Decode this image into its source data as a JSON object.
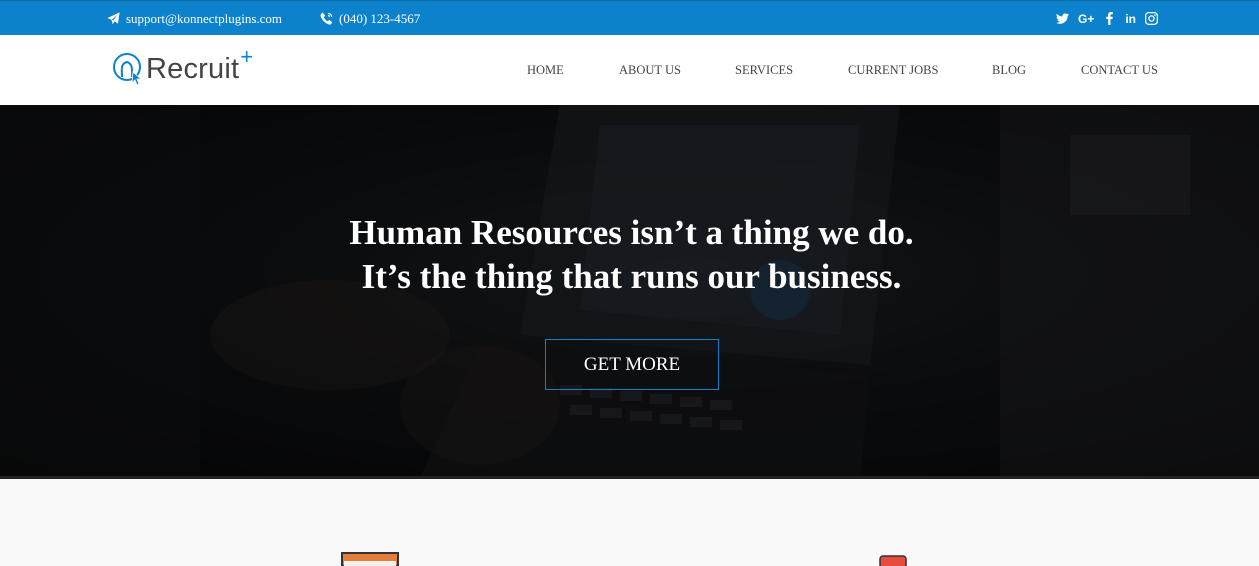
{
  "topbar": {
    "email": "support@konnectplugins.com",
    "phone": "(040) 123-4567",
    "social": [
      "twitter-icon",
      "google-plus-icon",
      "facebook-icon",
      "linkedin-icon",
      "instagram-icon"
    ],
    "google_plus_label": "G+",
    "linkedin_label": "in"
  },
  "logo": {
    "text": "Recruit",
    "plus": "+"
  },
  "nav": {
    "items": [
      "HOME",
      "ABOUT US",
      "SERVICES",
      "CURRENT JOBS",
      "BLOG",
      "CONTACT US"
    ]
  },
  "hero": {
    "line1": "Human Resources isn’t a thing we do.",
    "line2": "It’s the thing that runs our business.",
    "cta": "GET MORE"
  },
  "colors": {
    "accent": "#0d82cc",
    "topbar": "#0d82cc",
    "nav_text": "#444444",
    "hero_text": "#ffffff"
  }
}
